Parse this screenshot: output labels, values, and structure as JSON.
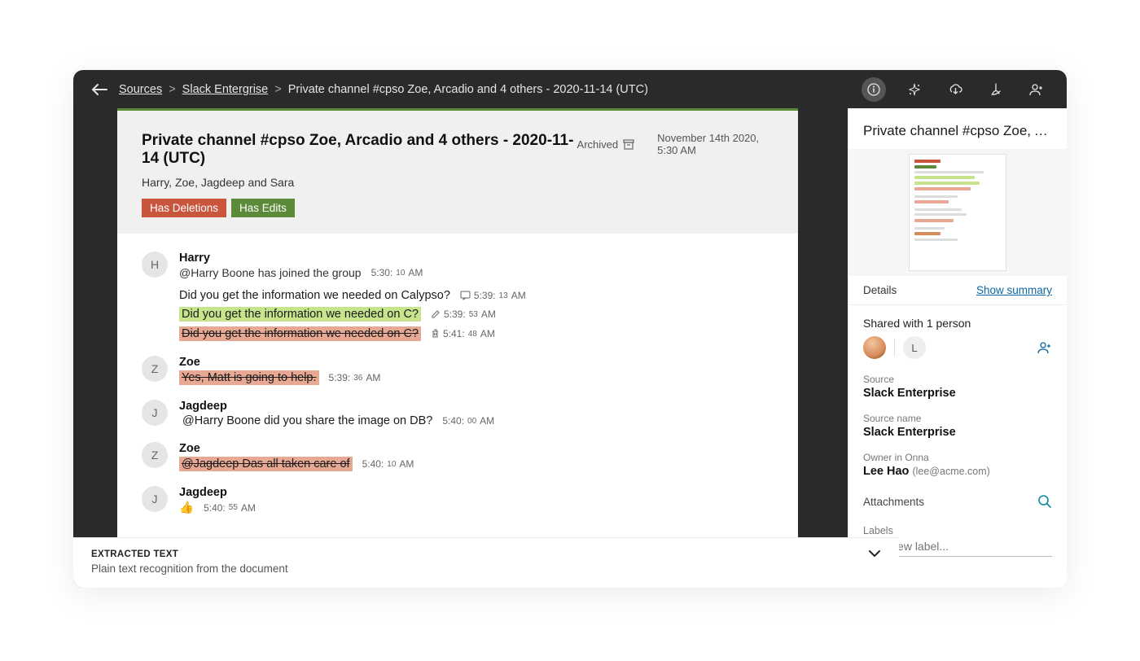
{
  "breadcrumb": {
    "sources": "Sources",
    "slack": "Slack Entergrise",
    "current": "Private channel #cpso Zoe, Arcadio and 4 others - 2020-11-14 (UTC)"
  },
  "doc": {
    "title": "Private channel #cpso Zoe, Arcadio and 4 others - 2020-11-14 (UTC)",
    "subtitle": "Harry, Zoe, Jagdeep and Sara",
    "archived": "Archived",
    "date": "November 14th 2020, 5:30 AM",
    "tag_del": "Has Deletions",
    "tag_edit": "Has Edits"
  },
  "messages": {
    "harry": {
      "name": "Harry",
      "initial": "H",
      "join": "@Harry Boone has joined the group",
      "join_time": "5:30:10 AM",
      "l1": "Did you get the information we needed on Calypso?",
      "l1_time": "5:39:13 AM",
      "l2": "Did you get the information we needed on C?",
      "l2_time": "5:39:53 AM",
      "l3": "Did you get the information we needed on C?",
      "l3_time": "5:41:48 AM"
    },
    "zoe1": {
      "name": "Zoe",
      "initial": "Z",
      "l1": "Yes, Matt is going to help.",
      "l1_time": "5:39:36 AM"
    },
    "jag1": {
      "name": "Jagdeep",
      "initial": "J",
      "l1": "@Harry Boone did you share the image on DB?",
      "l1_time": "5:40:00 AM"
    },
    "zoe2": {
      "name": "Zoe",
      "initial": "Z",
      "l1": "@Jagdeep Das all taken care of",
      "l1_time": "5:40:10 AM"
    },
    "jag2": {
      "name": "Jagdeep",
      "initial": "J",
      "l1": "👍",
      "l1_time": "5:40:55 AM"
    }
  },
  "extracted": {
    "title": "EXTRACTED TEXT",
    "sub": "Plain text recognition from the document"
  },
  "sidebar": {
    "title": "Private channel #cpso Zoe, Ar...",
    "tab_details": "Details",
    "tab_summary": "Show summary",
    "shared_label": "Shared with 1 person",
    "av2": "L",
    "source_label": "Source",
    "source_val": "Slack Enterprise",
    "srcname_label": "Source name",
    "srcname_val": "Slack Enterprise",
    "owner_label": "Owner in Onna",
    "owner_name": "Lee Hao",
    "owner_email": "(lee@acme.com)",
    "attachments": "Attachments",
    "labels": "Labels",
    "labels_placeholder": "Type new label..."
  }
}
